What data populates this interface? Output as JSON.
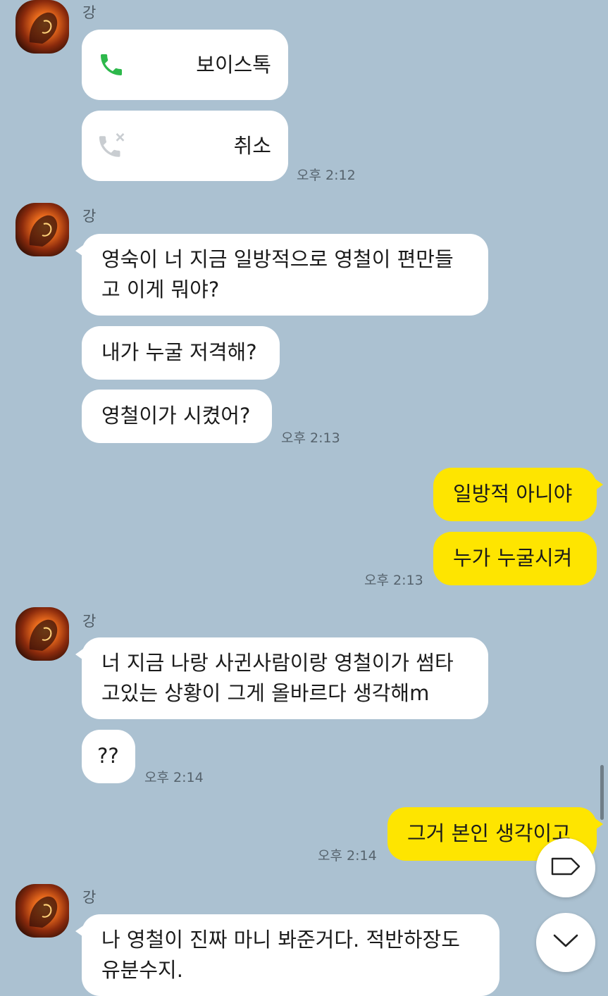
{
  "chat": {
    "sender_name": "강",
    "groups": [
      {
        "call_messages": [
          {
            "icon": "phone-icon",
            "label": "보이스톡"
          },
          {
            "icon": "phone-missed-icon",
            "label": "취소"
          }
        ],
        "time": "오후 2:12"
      },
      {
        "messages": [
          "영숙이 너 지금 일방적으로 영철이 편만들",
          "고 이게 뭐야?",
          "내가 누굴 저격해?",
          "영철이가 시켰어?"
        ],
        "time": "오후 2:13"
      },
      {
        "messages": [
          "너 지금 나랑 사귄사람이랑 영철이가 썸타",
          "고있는 상황이 그게 올바르다 생각해m",
          "??"
        ],
        "time": "오후 2:14"
      },
      {
        "messages": [
          "나 영철이 진짜 마니 봐준거다. 적반하장도",
          "유분수지."
        ]
      }
    ],
    "my_groups": [
      {
        "messages": [
          "일방적 아니야",
          "누가 누굴시켜"
        ],
        "time": "오후 2:13"
      },
      {
        "messages": [
          "그거 본인 생각이고"
        ],
        "time": "오후 2:14"
      }
    ]
  },
  "controls": {
    "tag_button_icon": "tag-icon",
    "scroll_down_icon": "chevron-down-icon"
  },
  "colors": {
    "background": "#abc1d1",
    "my_bubble": "#fee500",
    "their_bubble": "#ffffff",
    "call_green": "#2db84b"
  }
}
